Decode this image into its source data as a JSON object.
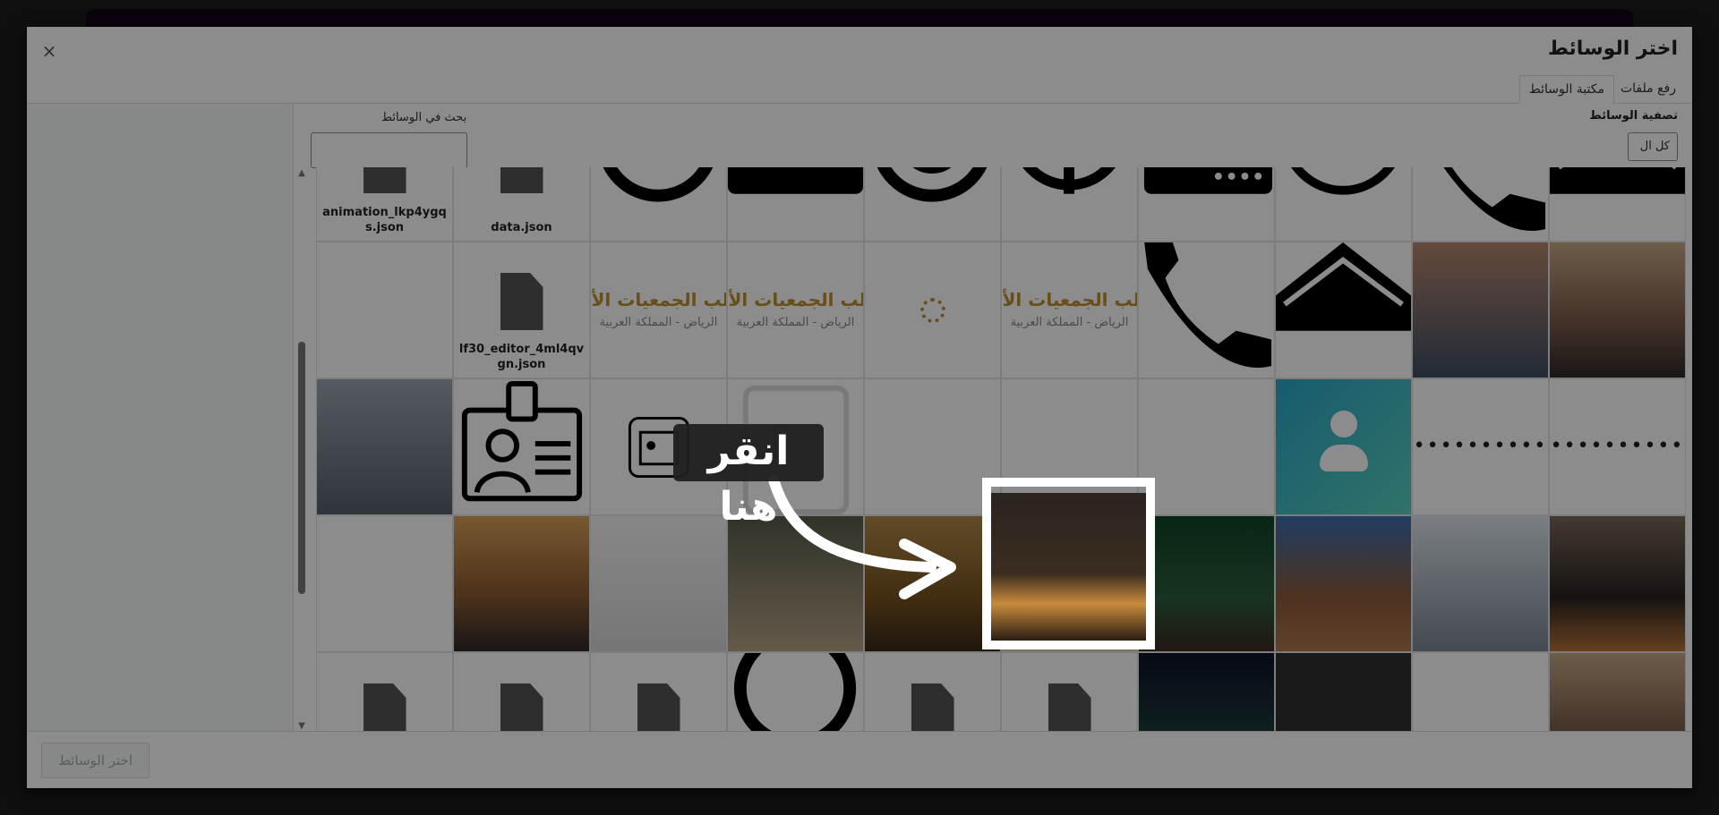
{
  "modal": {
    "title": "اختر الوسائط",
    "close_symbol": "×"
  },
  "tabs": [
    {
      "label": "رفع ملفات"
    },
    {
      "label": "مكتبة الوسائط"
    }
  ],
  "filter": {
    "label": "تصفية الوسائط",
    "selected": "كل ال"
  },
  "search": {
    "label": "بحث في الوسائط",
    "placeholder": ""
  },
  "grid": {
    "tiles": [
      {
        "type": "file",
        "caption": "animation_lkp4ygqs.json"
      },
      {
        "type": "file",
        "caption": "data.json"
      },
      {
        "type": "icon-black",
        "icon": "circle-icon"
      },
      {
        "type": "icon-black",
        "icon": "briefcase-icon"
      },
      {
        "type": "icon-black",
        "icon": "target-icon"
      },
      {
        "type": "icon-black",
        "icon": "podcast-icon"
      },
      {
        "type": "icon-black",
        "icon": "keyboard-icon"
      },
      {
        "type": "icon-black",
        "icon": "search-icon"
      },
      {
        "type": "icon-black",
        "icon": "phone-icon"
      },
      {
        "type": "icon-black",
        "icon": "envelope-icon"
      },
      {
        "type": "image",
        "style": "white",
        "name": "form-screenshot"
      },
      {
        "type": "file",
        "caption": "lf30_editor_4ml4qvgn.json"
      },
      {
        "type": "logo-text",
        "text": "الب الجمعيات الأهلية",
        "sub": "الرياض - المملكة العربية"
      },
      {
        "type": "logo-text",
        "text": "الب الجمعيات الأهلية",
        "sub": "الرياض - المملكة العربية"
      },
      {
        "type": "logo-mark"
      },
      {
        "type": "logo-text",
        "text": "الب الجمعيات الأهلية",
        "sub": "الرياض - المملكة العربية"
      },
      {
        "type": "icon-black",
        "icon": "phone-icon"
      },
      {
        "type": "icon-black",
        "icon": "envelope-icon"
      },
      {
        "type": "image",
        "style": "grad1",
        "name": "skyline-fog-photo"
      },
      {
        "type": "image",
        "style": "grad2",
        "name": "man-phone-photo"
      },
      {
        "type": "image",
        "style": "grad3",
        "name": "kingdom-tower-photo"
      },
      {
        "type": "icon-black",
        "icon": "id-badge-icon"
      },
      {
        "type": "icon-black",
        "icon": "id-badge-small-icon"
      },
      {
        "type": "icon-black",
        "icon": "clipboard-icon"
      },
      {
        "type": "image",
        "style": "white",
        "name": "blank-image"
      },
      {
        "type": "image",
        "style": "white",
        "name": "growth-chart-image"
      },
      {
        "type": "image",
        "style": "white",
        "name": "infographic-image"
      },
      {
        "type": "image",
        "style": "teal",
        "name": "user-avatar-image"
      },
      {
        "type": "dots",
        "text": "••••••••••"
      },
      {
        "type": "dots",
        "text": "••••••••••"
      },
      {
        "type": "image",
        "style": "white",
        "name": "org-chart-image"
      },
      {
        "type": "image",
        "style": "grad4",
        "name": "city-sunset-photo"
      },
      {
        "type": "image",
        "style": "grad5",
        "name": "child-hospital-photo"
      },
      {
        "type": "image",
        "style": "grad6",
        "name": "elders-talking-photo"
      },
      {
        "type": "image",
        "style": "grad7",
        "name": "hands-dates-photo"
      },
      {
        "type": "image",
        "style": "grad8",
        "name": "riyadh-night-photo"
      },
      {
        "type": "image",
        "style": "grad9",
        "name": "dates-bowl-photo"
      },
      {
        "type": "image",
        "style": "grad10",
        "name": "building-photo"
      },
      {
        "type": "image",
        "style": "grad11",
        "name": "business-meeting-photo"
      },
      {
        "type": "image",
        "style": "grad12",
        "name": "towers-sunset-photo"
      },
      {
        "type": "file",
        "caption": ""
      },
      {
        "type": "file",
        "caption": ""
      },
      {
        "type": "file",
        "caption": ""
      },
      {
        "type": "icon-black",
        "icon": "circle-icon"
      },
      {
        "type": "file",
        "caption": ""
      },
      {
        "type": "file",
        "caption": ""
      },
      {
        "type": "image",
        "style": "night",
        "name": "highway-night-photo"
      },
      {
        "type": "image",
        "style": "dark",
        "name": "dark-pattern-image"
      },
      {
        "type": "image",
        "style": "white",
        "name": "org-chart-image-2"
      },
      {
        "type": "image",
        "style": "grad2",
        "name": "men-desert-photo"
      }
    ]
  },
  "footer": {
    "select_button": "اختر الوسائط"
  },
  "tutorial": {
    "tooltip": "انقر هنا"
  }
}
